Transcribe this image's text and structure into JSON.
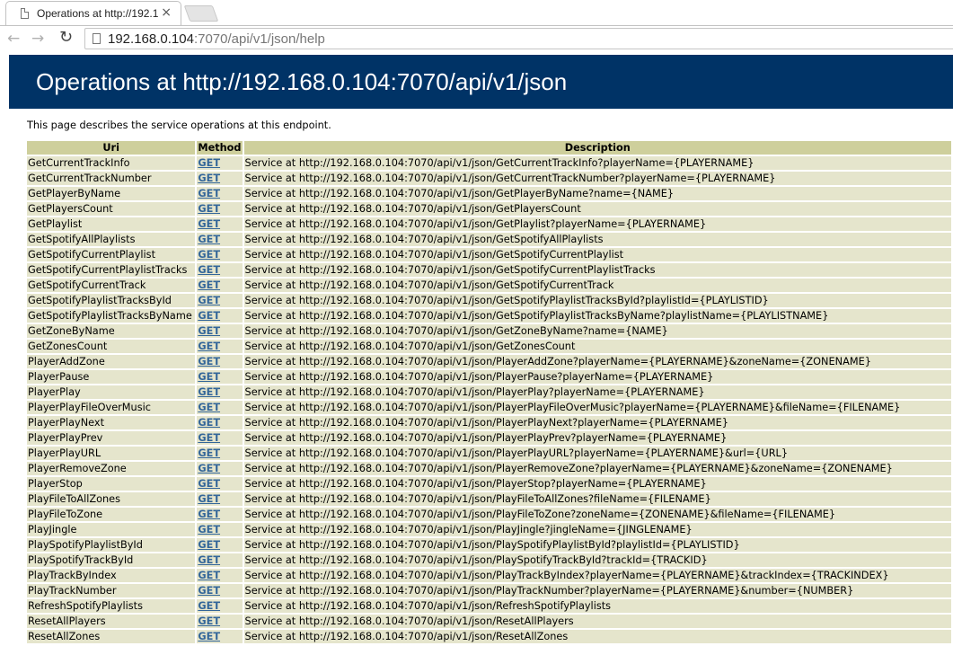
{
  "browser": {
    "tab_title": "Operations at http://192.1",
    "tab_close": "×",
    "url_host": "192.168.0.104",
    "url_rest": ":7070/api/v1/json/help"
  },
  "page": {
    "heading": "Operations at http://192.168.0.104:7070/api/v1/json",
    "intro": "This page describes the service operations at this endpoint.",
    "columns": {
      "uri": "Uri",
      "method": "Method",
      "description": "Description"
    },
    "operations": [
      {
        "uri": "GetCurrentTrackInfo",
        "method": "GET",
        "description": "Service at http://192.168.0.104:7070/api/v1/json/GetCurrentTrackInfo?playerName={PLAYERNAME}"
      },
      {
        "uri": "GetCurrentTrackNumber",
        "method": "GET",
        "description": "Service at http://192.168.0.104:7070/api/v1/json/GetCurrentTrackNumber?playerName={PLAYERNAME}"
      },
      {
        "uri": "GetPlayerByName",
        "method": "GET",
        "description": "Service at http://192.168.0.104:7070/api/v1/json/GetPlayerByName?name={NAME}"
      },
      {
        "uri": "GetPlayersCount",
        "method": "GET",
        "description": "Service at http://192.168.0.104:7070/api/v1/json/GetPlayersCount"
      },
      {
        "uri": "GetPlaylist",
        "method": "GET",
        "description": "Service at http://192.168.0.104:7070/api/v1/json/GetPlaylist?playerName={PLAYERNAME}"
      },
      {
        "uri": "GetSpotifyAllPlaylists",
        "method": "GET",
        "description": "Service at http://192.168.0.104:7070/api/v1/json/GetSpotifyAllPlaylists"
      },
      {
        "uri": "GetSpotifyCurrentPlaylist",
        "method": "GET",
        "description": "Service at http://192.168.0.104:7070/api/v1/json/GetSpotifyCurrentPlaylist"
      },
      {
        "uri": "GetSpotifyCurrentPlaylistTracks",
        "method": "GET",
        "description": "Service at http://192.168.0.104:7070/api/v1/json/GetSpotifyCurrentPlaylistTracks"
      },
      {
        "uri": "GetSpotifyCurrentTrack",
        "method": "GET",
        "description": "Service at http://192.168.0.104:7070/api/v1/json/GetSpotifyCurrentTrack"
      },
      {
        "uri": "GetSpotifyPlaylistTracksById",
        "method": "GET",
        "description": "Service at http://192.168.0.104:7070/api/v1/json/GetSpotifyPlaylistTracksById?playlistId={PLAYLISTID}"
      },
      {
        "uri": "GetSpotifyPlaylistTracksByName",
        "method": "GET",
        "description": "Service at http://192.168.0.104:7070/api/v1/json/GetSpotifyPlaylistTracksByName?playlistName={PLAYLISTNAME}"
      },
      {
        "uri": "GetZoneByName",
        "method": "GET",
        "description": "Service at http://192.168.0.104:7070/api/v1/json/GetZoneByName?name={NAME}"
      },
      {
        "uri": "GetZonesCount",
        "method": "GET",
        "description": "Service at http://192.168.0.104:7070/api/v1/json/GetZonesCount"
      },
      {
        "uri": "PlayerAddZone",
        "method": "GET",
        "description": "Service at http://192.168.0.104:7070/api/v1/json/PlayerAddZone?playerName={PLAYERNAME}&zoneName={ZONENAME}"
      },
      {
        "uri": "PlayerPause",
        "method": "GET",
        "description": "Service at http://192.168.0.104:7070/api/v1/json/PlayerPause?playerName={PLAYERNAME}"
      },
      {
        "uri": "PlayerPlay",
        "method": "GET",
        "description": "Service at http://192.168.0.104:7070/api/v1/json/PlayerPlay?playerName={PLAYERNAME}"
      },
      {
        "uri": "PlayerPlayFileOverMusic",
        "method": "GET",
        "description": "Service at http://192.168.0.104:7070/api/v1/json/PlayerPlayFileOverMusic?playerName={PLAYERNAME}&fileName={FILENAME}"
      },
      {
        "uri": "PlayerPlayNext",
        "method": "GET",
        "description": "Service at http://192.168.0.104:7070/api/v1/json/PlayerPlayNext?playerName={PLAYERNAME}"
      },
      {
        "uri": "PlayerPlayPrev",
        "method": "GET",
        "description": "Service at http://192.168.0.104:7070/api/v1/json/PlayerPlayPrev?playerName={PLAYERNAME}"
      },
      {
        "uri": "PlayerPlayURL",
        "method": "GET",
        "description": "Service at http://192.168.0.104:7070/api/v1/json/PlayerPlayURL?playerName={PLAYERNAME}&url={URL}"
      },
      {
        "uri": "PlayerRemoveZone",
        "method": "GET",
        "description": "Service at http://192.168.0.104:7070/api/v1/json/PlayerRemoveZone?playerName={PLAYERNAME}&zoneName={ZONENAME}"
      },
      {
        "uri": "PlayerStop",
        "method": "GET",
        "description": "Service at http://192.168.0.104:7070/api/v1/json/PlayerStop?playerName={PLAYERNAME}"
      },
      {
        "uri": "PlayFileToAllZones",
        "method": "GET",
        "description": "Service at http://192.168.0.104:7070/api/v1/json/PlayFileToAllZones?fileName={FILENAME}"
      },
      {
        "uri": "PlayFileToZone",
        "method": "GET",
        "description": "Service at http://192.168.0.104:7070/api/v1/json/PlayFileToZone?zoneName={ZONENAME}&fileName={FILENAME}"
      },
      {
        "uri": "PlayJingle",
        "method": "GET",
        "description": "Service at http://192.168.0.104:7070/api/v1/json/PlayJingle?jingleName={JINGLENAME}"
      },
      {
        "uri": "PlaySpotifyPlaylistById",
        "method": "GET",
        "description": "Service at http://192.168.0.104:7070/api/v1/json/PlaySpotifyPlaylistById?playlistId={PLAYLISTID}"
      },
      {
        "uri": "PlaySpotifyTrackById",
        "method": "GET",
        "description": "Service at http://192.168.0.104:7070/api/v1/json/PlaySpotifyTrackById?trackId={TRACKID}"
      },
      {
        "uri": "PlayTrackByIndex",
        "method": "GET",
        "description": "Service at http://192.168.0.104:7070/api/v1/json/PlayTrackByIndex?playerName={PLAYERNAME}&trackIndex={TRACKINDEX}"
      },
      {
        "uri": "PlayTrackNumber",
        "method": "GET",
        "description": "Service at http://192.168.0.104:7070/api/v1/json/PlayTrackNumber?playerName={PLAYERNAME}&number={NUMBER}"
      },
      {
        "uri": "RefreshSpotifyPlaylists",
        "method": "GET",
        "description": "Service at http://192.168.0.104:7070/api/v1/json/RefreshSpotifyPlaylists"
      },
      {
        "uri": "ResetAllPlayers",
        "method": "GET",
        "description": "Service at http://192.168.0.104:7070/api/v1/json/ResetAllPlayers"
      },
      {
        "uri": "ResetAllZones",
        "method": "GET",
        "description": "Service at http://192.168.0.104:7070/api/v1/json/ResetAllZones"
      }
    ]
  },
  "colors": {
    "banner": "#003366",
    "header_cell": "#cecf9c",
    "body_cell": "#e5e5cc",
    "link": "#336699"
  }
}
